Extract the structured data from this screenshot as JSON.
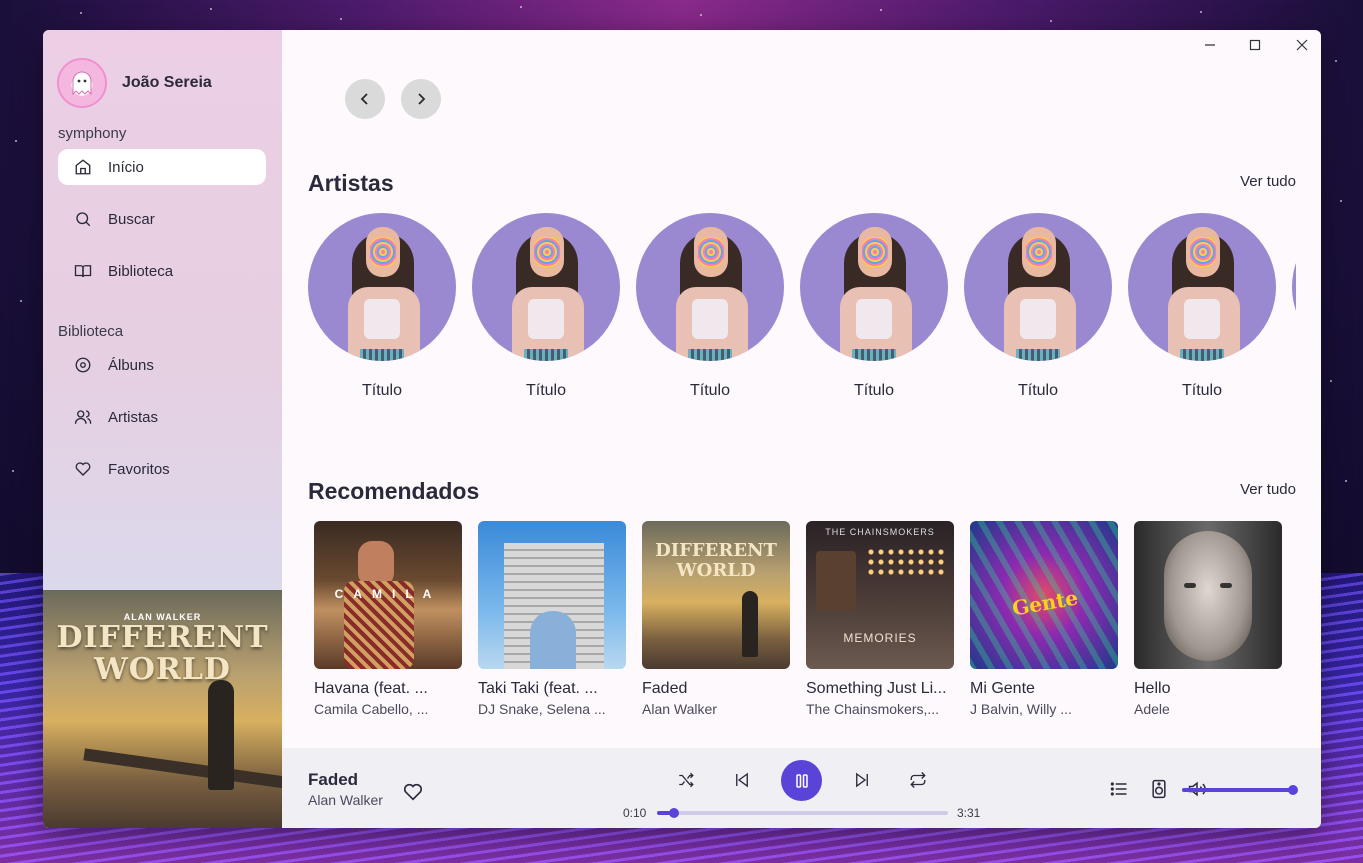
{
  "user": {
    "name": "João Sereia"
  },
  "sidebar": {
    "app_label": "symphony",
    "nav": [
      {
        "label": "Início",
        "icon": "home-icon",
        "active": true
      },
      {
        "label": "Buscar",
        "icon": "search-icon",
        "active": false
      },
      {
        "label": "Biblioteca",
        "icon": "book-icon",
        "active": false
      }
    ],
    "library_label": "Biblioteca",
    "library": [
      {
        "label": "Álbuns",
        "icon": "disc-icon"
      },
      {
        "label": "Artistas",
        "icon": "users-icon"
      },
      {
        "label": "Favoritos",
        "icon": "heart-icon"
      }
    ]
  },
  "now_playing_cover": {
    "brand": "ALAN WALKER",
    "title": "DIFFERENT WORLD"
  },
  "artists_section": {
    "title": "Artistas",
    "see_all": "Ver tudo",
    "items": [
      "Título",
      "Título",
      "Título",
      "Título",
      "Título",
      "Título"
    ]
  },
  "recommended_section": {
    "title": "Recomendados",
    "see_all": "Ver tudo",
    "items": [
      {
        "title": "Havana (feat. ...",
        "artist": "Camila Cabello, ..."
      },
      {
        "title": "Taki Taki (feat. ...",
        "artist": "DJ Snake, Selena ..."
      },
      {
        "title": "Faded",
        "artist": "Alan Walker"
      },
      {
        "title": "Something Just Li...",
        "artist": "The Chainsmokers,..."
      },
      {
        "title": "Mi Gente",
        "artist": "J Balvin, Willy ..."
      },
      {
        "title": "Hello",
        "artist": "Adele"
      }
    ]
  },
  "player": {
    "title": "Faded",
    "artist": "Alan Walker",
    "elapsed": "0:10",
    "duration": "3:31",
    "progress": 0.06,
    "volume": 1.0,
    "accent": "#5a44d8"
  }
}
